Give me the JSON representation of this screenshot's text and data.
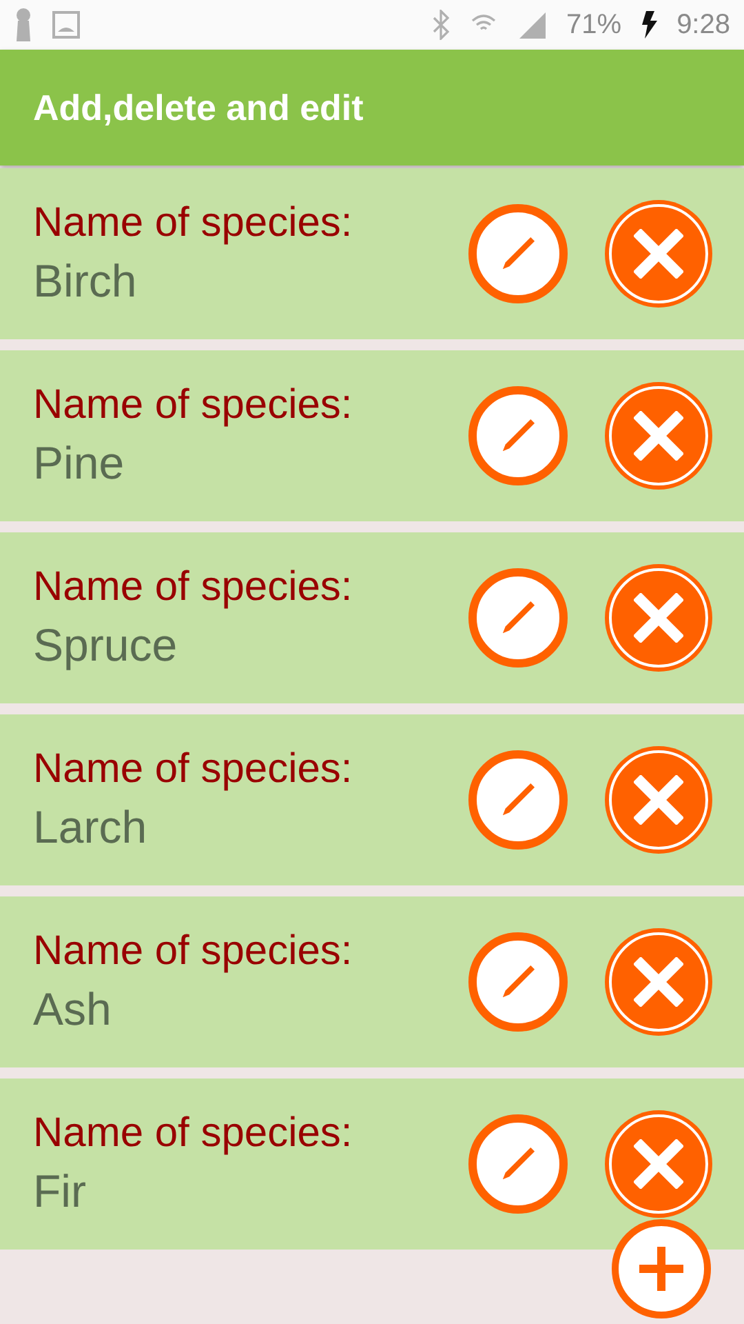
{
  "status_bar": {
    "battery": "71%",
    "time": "9:28"
  },
  "app_bar": {
    "title": "Add,delete and edit"
  },
  "species": [
    {
      "label": "Name of species:",
      "name": "Birch"
    },
    {
      "label": "Name of species:",
      "name": "Pine"
    },
    {
      "label": "Name of species:",
      "name": "Spruce"
    },
    {
      "label": "Name of species:",
      "name": "Larch"
    },
    {
      "label": "Name of species:",
      "name": "Ash"
    },
    {
      "label": "Name of species:",
      "name": "Fir"
    }
  ]
}
